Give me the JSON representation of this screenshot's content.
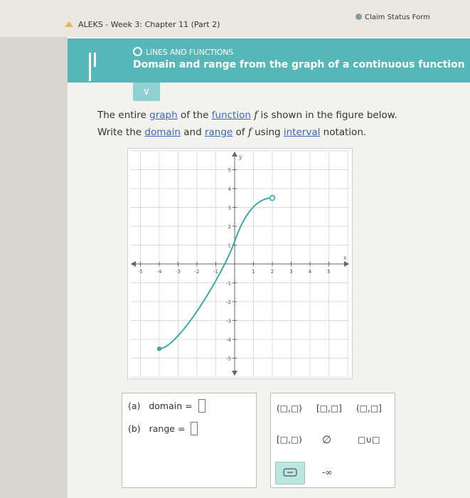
{
  "browser": {
    "tab_title": "ALEKS - Week 3: Chapter 11 (Part 2)",
    "claim_link": "Claim Status Form"
  },
  "header": {
    "topic": "LINES AND FUNCTIONS",
    "lesson_title": "Domain and range from the graph of a continuous function"
  },
  "question": {
    "line1": {
      "t1": "The entire ",
      "graph": "graph",
      "t2": " of the ",
      "function": "function",
      "f": "f",
      "t3": " is shown in the figure below."
    },
    "line2": {
      "t1": "Write the ",
      "domain": "domain",
      "t2": " and ",
      "range": "range",
      "t3": " of ",
      "f": "f",
      "t4": " using ",
      "interval": "interval",
      "t5": " notation."
    }
  },
  "graph": {
    "x_label": "x",
    "y_label": "y",
    "x_ticks": [
      "-5",
      "-4",
      "-3",
      "-2",
      "-1",
      "1",
      "2",
      "3",
      "4",
      "5"
    ],
    "y_ticks": [
      "5",
      "4",
      "3",
      "2",
      "1",
      "-1",
      "-2",
      "-3",
      "-4",
      "-5"
    ],
    "curve_color": "#3aa8a8",
    "start_point": {
      "x": -4,
      "y": -4.5,
      "type": "closed"
    },
    "end_point": {
      "x": 2,
      "y": 3.5,
      "type": "open"
    },
    "x_range": [
      -6,
      6
    ],
    "y_range": [
      -6,
      6
    ]
  },
  "answers": {
    "a_label": "(a)",
    "domain_label": "domain =",
    "b_label": "(b)",
    "range_label": "range ="
  },
  "palette": {
    "open_open": "(□,□)",
    "closed_closed": "[□,□]",
    "open_closed": "(□,□]",
    "closed_open": "[□,□)",
    "empty_set": "∅",
    "union": "□∪□",
    "neg_infinity": "-∞"
  }
}
